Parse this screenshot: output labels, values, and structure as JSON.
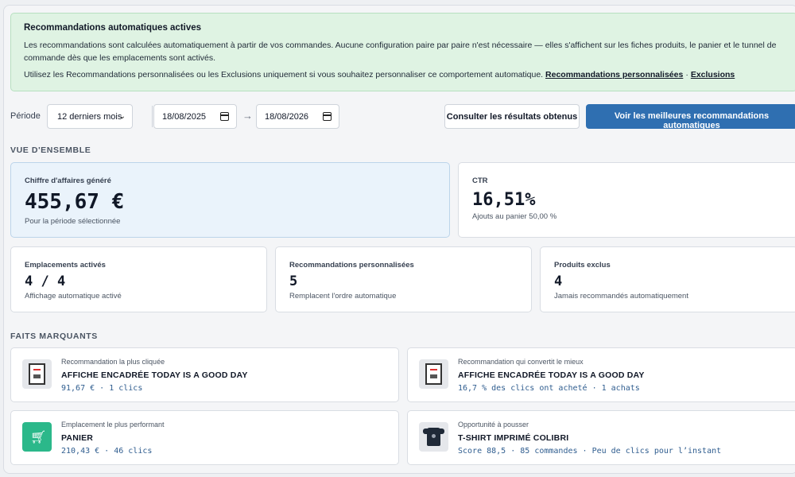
{
  "banner": {
    "title": "Recommandations automatiques actives",
    "text": "Les recommandations sont calculées automatiquement à partir de vos commandes. Aucune configuration paire par paire n'est nécessaire — elles s'affichent sur les fiches produits, le panier et le tunnel de commande dès que les emplacements sont activés.",
    "text2": "Utilisez les Recommandations personnalisées ou les Exclusions uniquement si vous souhaitez personnaliser ce comportement automatique.",
    "link_custom": "Recommandations personnalisées",
    "separator": "·",
    "link_exclusions": "Exclusions"
  },
  "filters": {
    "periode_label": "Période",
    "period_select": "12 derniers mois",
    "date_from": "18/08/2025",
    "arrow": "→",
    "date_to": "18/08/2026",
    "consult_button": "Consulter les résultats obtenus",
    "primary_button": "Voir les meilleures recommandations automatiques"
  },
  "overview": {
    "title": "VUE D'ENSEMBLE",
    "revenue": {
      "label": "Chiffre d'affaires généré",
      "value": "455,67 €",
      "sub": "Pour la période sélectionnée"
    },
    "ctr": {
      "label": "CTR",
      "value": "16,51%",
      "sub": "Ajouts au panier 50,00 %"
    },
    "slots": {
      "label": "Emplacements activés",
      "value": "4 / 4",
      "sub": "Affichage automatique activé"
    },
    "custom": {
      "label": "Recommandations personnalisées",
      "value": "5",
      "sub": "Remplacent l'ordre automatique"
    },
    "excluded": {
      "label": "Produits exclus",
      "value": "4",
      "sub": "Jamais recommandés automatiquement"
    }
  },
  "highlights": {
    "title": "FAITS MARQUANTS",
    "items": [
      {
        "kicker": "Recommandation la plus cliquée",
        "name": "AFFICHE ENCADRÉE TODAY IS A GOOD DAY",
        "meta": "91,67 € · 1 clics",
        "icon": "poster-icon"
      },
      {
        "kicker": "Recommandation qui convertit le mieux",
        "name": "AFFICHE ENCADRÉE TODAY IS A GOOD DAY",
        "meta": "16,7 % des clics ont acheté · 1 achats",
        "icon": "poster-icon"
      },
      {
        "kicker": "Emplacement le plus performant",
        "name": "PANIER",
        "meta": "210,43 € · 46 clics",
        "icon": "cart-icon"
      },
      {
        "kicker": "Opportunité à pousser",
        "name": "T-SHIRT IMPRIMÉ COLIBRI",
        "meta": "Score 88,5 · 85 commandes · Peu de clics pour l’instant",
        "icon": "tshirt-icon"
      }
    ]
  },
  "colors": {
    "accent": "#2f6fb1",
    "banner_bg": "#dff3e3",
    "cart_green": "#2bb88a"
  }
}
